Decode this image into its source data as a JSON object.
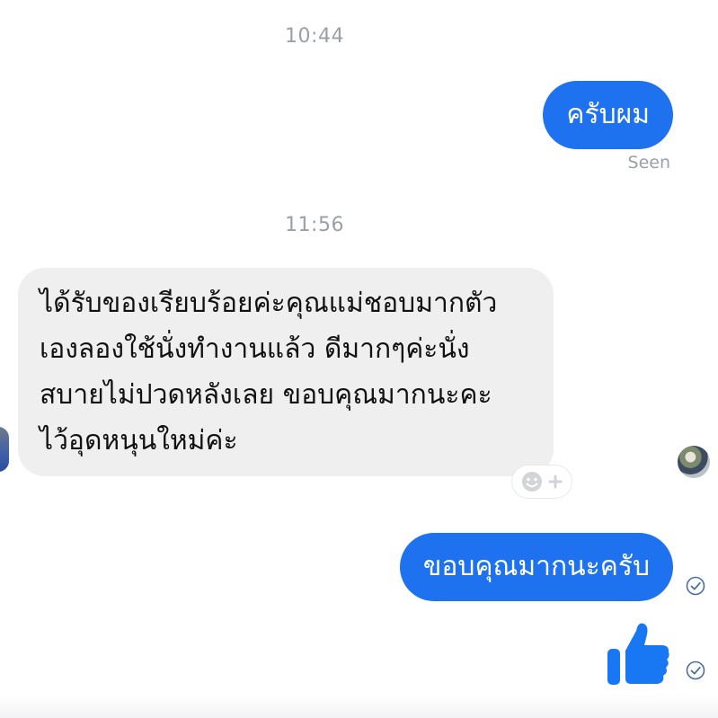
{
  "thread": {
    "timestamps": [
      "10:44",
      "11:56"
    ],
    "seen_label": "Seen",
    "messages": [
      {
        "sender": "me",
        "text": "ครับผม"
      },
      {
        "sender": "them",
        "lines": [
          "ได้รับของเรียบร้อยค่ะคุณแม่ชอบมากตัว",
          "เองลองใช้นั่งทำงานแล้ว ดีมากๆค่ะนั่ง",
          "สบายไม่ปวดหลังเลย ขอบคุณมากนะคะ",
          "ไว้อุดหนุนใหม่ค่ะ"
        ]
      },
      {
        "sender": "me",
        "text": "ขอบคุณมากนะครับ"
      },
      {
        "sender": "me",
        "type": "like-sticker"
      }
    ]
  },
  "icons": {
    "react": "add-reaction-icon",
    "delivered": "delivered-check-icon",
    "like": "thumbs-up-icon",
    "avatar": "read-receipt-avatar"
  },
  "colors": {
    "outgoing_bubble": "#1e72f0",
    "incoming_bubble": "#efeff0",
    "meta_text": "#9aa0a6",
    "like": "#1877f2"
  }
}
